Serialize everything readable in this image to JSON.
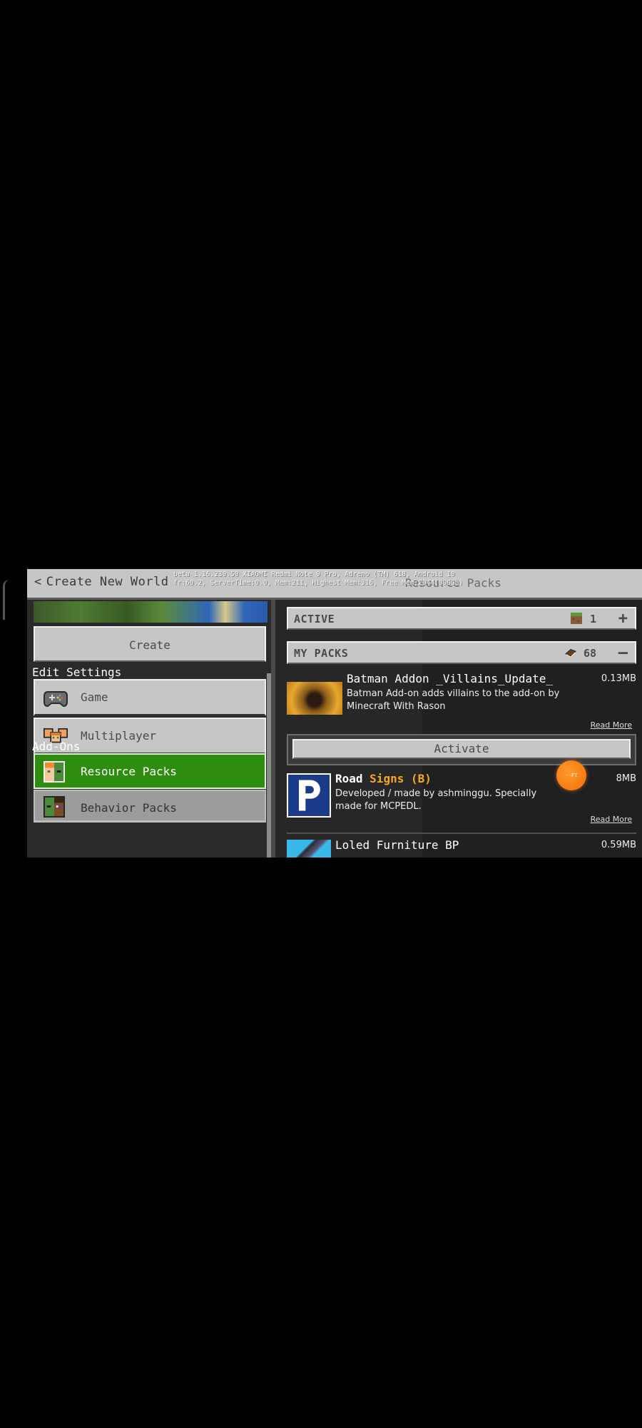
{
  "header": {
    "back_label": "Create New World",
    "back_icon": "chevron-left-icon",
    "debug_line1": "beta 1.16.230.50 XIAOMI Redmi Note 9 Pro, Adreno (TM) 618, Android 10",
    "debug_line2": "fr:60.2, ServerTime:0.0, Mem:211, Highest Mem:316, Free Mem:2044(000Gb)",
    "title": "Resource Packs"
  },
  "left_panel": {
    "create_label": "Create",
    "edit_settings_label": "Edit Settings",
    "settings_items": [
      {
        "label": "Game",
        "icon": "controller-icon"
      },
      {
        "label": "Multiplayer",
        "icon": "players-icon"
      }
    ],
    "addons_label": "Add-Ons",
    "addon_items": [
      {
        "label": "Resource Packs",
        "icon": "resource-pack-icon",
        "selected": true
      },
      {
        "label": "Behavior Packs",
        "icon": "behavior-pack-icon",
        "selected": false
      }
    ]
  },
  "right_panel": {
    "active": {
      "title": "ACTIVE",
      "count": "1",
      "icon": "grass-block-icon",
      "toggle": "+"
    },
    "my_packs": {
      "title": "MY PACKS",
      "count": "68",
      "icon": "book-icon",
      "toggle": "—"
    },
    "packs": [
      {
        "name": "Batman Addon _Villains_Update_",
        "size": "0.13MB",
        "description": "Batman Add-on adds villains to the add-on by Minecraft With Rason",
        "read_more": "Read More"
      },
      {
        "name_part1": "Road ",
        "name_part2": "Signs (B)",
        "name_part2_color": "#f5a623",
        "size": "8MB",
        "description": "Developed / made by ashminggu. Specially made for MCPEDL.",
        "read_more": "Read More"
      },
      {
        "name": "Loled Furniture BP",
        "size": "0.59MB"
      }
    ],
    "activate_label": "Activate"
  },
  "overlay": {
    "bubble_text": "··FT"
  },
  "colors": {
    "selected_green": "#2e8d0e",
    "button_gray": "#c6c6c6",
    "accent_orange": "#f5a623",
    "bubble_orange": "#f26d0a"
  }
}
